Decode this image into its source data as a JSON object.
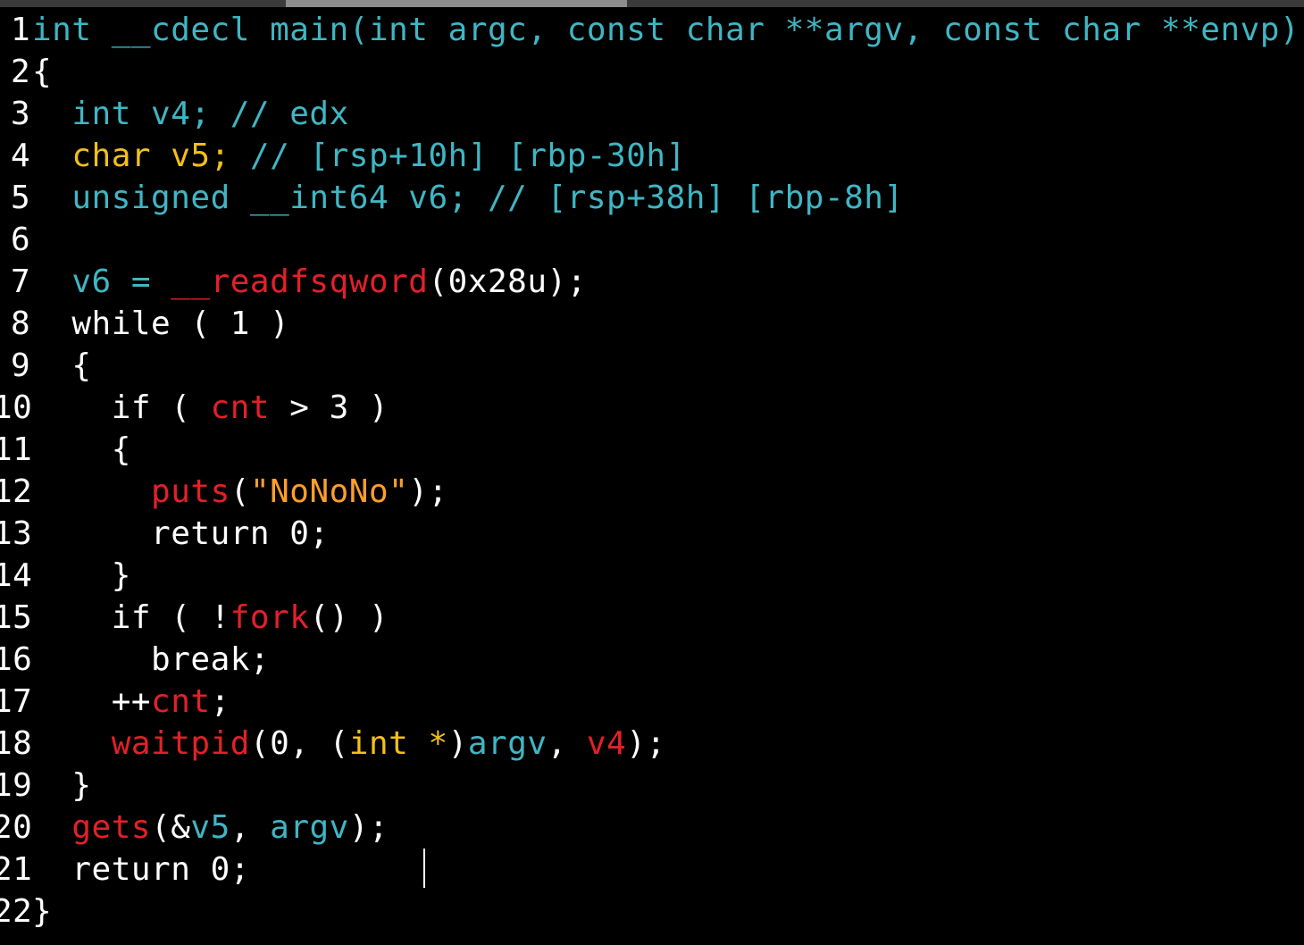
{
  "colors": {
    "background": "#000000",
    "plain": "#ffffff",
    "type_keyword": "#3fb6c4",
    "highlight_type": "#f2c01a",
    "function_call": "#e3202a",
    "string_literal": "#ff9e2c"
  },
  "editor": {
    "lines": [
      {
        "number": "1",
        "tokens": [
          {
            "t": "int __cdecl main(int argc, const char **argv, const char **envp)",
            "c": "teal"
          }
        ]
      },
      {
        "number": "2",
        "tokens": [
          {
            "t": "{",
            "c": "white"
          }
        ]
      },
      {
        "number": "3",
        "tokens": [
          {
            "t": "  int v4; // edx",
            "c": "teal"
          }
        ]
      },
      {
        "number": "4",
        "tokens": [
          {
            "t": "  char v5; ",
            "c": "yellow"
          },
          {
            "t": "// [rsp+10h] [rbp-30h]",
            "c": "teal"
          }
        ]
      },
      {
        "number": "5",
        "tokens": [
          {
            "t": "  unsigned __int64 v6; // [rsp+38h] [rbp-8h]",
            "c": "teal"
          }
        ]
      },
      {
        "number": "6",
        "tokens": []
      },
      {
        "number": "7",
        "tokens": [
          {
            "t": "  v6 = ",
            "c": "teal"
          },
          {
            "t": "__readfsqword",
            "c": "red"
          },
          {
            "t": "(0x28u);",
            "c": "white"
          }
        ]
      },
      {
        "number": "8",
        "tokens": [
          {
            "t": "  while ( 1 )",
            "c": "white"
          }
        ]
      },
      {
        "number": "9",
        "tokens": [
          {
            "t": "  {",
            "c": "white"
          }
        ]
      },
      {
        "number": "10",
        "tokens": [
          {
            "t": "    if ( ",
            "c": "white"
          },
          {
            "t": "cnt",
            "c": "red"
          },
          {
            "t": " > 3 )",
            "c": "white"
          }
        ]
      },
      {
        "number": "11",
        "tokens": [
          {
            "t": "    {",
            "c": "white"
          }
        ]
      },
      {
        "number": "12",
        "tokens": [
          {
            "t": "      ",
            "c": "white"
          },
          {
            "t": "puts",
            "c": "red"
          },
          {
            "t": "(",
            "c": "white"
          },
          {
            "t": "\"NoNoNo\"",
            "c": "orange"
          },
          {
            "t": ");",
            "c": "white"
          }
        ]
      },
      {
        "number": "13",
        "tokens": [
          {
            "t": "      return 0;",
            "c": "white"
          }
        ]
      },
      {
        "number": "14",
        "tokens": [
          {
            "t": "    }",
            "c": "white"
          }
        ]
      },
      {
        "number": "15",
        "tokens": [
          {
            "t": "    if ( !",
            "c": "white"
          },
          {
            "t": "fork",
            "c": "red"
          },
          {
            "t": "() )",
            "c": "white"
          }
        ]
      },
      {
        "number": "16",
        "tokens": [
          {
            "t": "      break;",
            "c": "white"
          }
        ]
      },
      {
        "number": "17",
        "tokens": [
          {
            "t": "    ++",
            "c": "white"
          },
          {
            "t": "cnt",
            "c": "red"
          },
          {
            "t": ";",
            "c": "white"
          }
        ]
      },
      {
        "number": "18",
        "tokens": [
          {
            "t": "    ",
            "c": "white"
          },
          {
            "t": "waitpid",
            "c": "red"
          },
          {
            "t": "(0, (",
            "c": "white"
          },
          {
            "t": "int *",
            "c": "yellow"
          },
          {
            "t": ")",
            "c": "white"
          },
          {
            "t": "argv",
            "c": "teal"
          },
          {
            "t": ", ",
            "c": "white"
          },
          {
            "t": "v4",
            "c": "red"
          },
          {
            "t": ");",
            "c": "white"
          }
        ]
      },
      {
        "number": "19",
        "tokens": [
          {
            "t": "  }",
            "c": "white"
          }
        ]
      },
      {
        "number": "20",
        "tokens": [
          {
            "t": "  ",
            "c": "white"
          },
          {
            "t": "gets",
            "c": "red"
          },
          {
            "t": "(&",
            "c": "white"
          },
          {
            "t": "v5",
            "c": "teal"
          },
          {
            "t": ", ",
            "c": "white"
          },
          {
            "t": "argv",
            "c": "teal"
          },
          {
            "t": ");",
            "c": "white"
          }
        ]
      },
      {
        "number": "21",
        "tokens": [
          {
            "t": "  return 0;",
            "c": "white"
          }
        ]
      },
      {
        "number": "22",
        "tokens": [
          {
            "t": "}",
            "c": "white"
          }
        ]
      }
    ]
  }
}
